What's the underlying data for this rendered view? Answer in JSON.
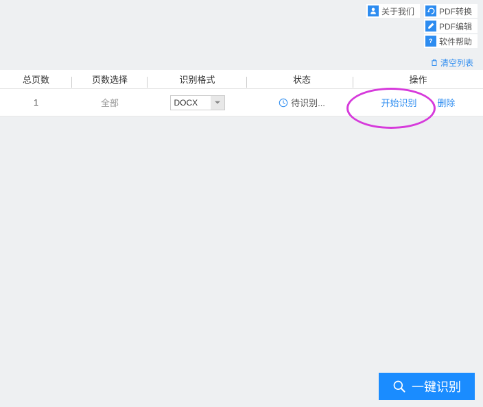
{
  "toolbar": {
    "about_us": "关于我们",
    "pdf_convert": "PDF转换",
    "pdf_edit": "PDF编辑",
    "software_help": "软件帮助"
  },
  "clear_list": "清空列表",
  "headers": {
    "total_pages": "总页数",
    "page_select": "页数选择",
    "format": "识别格式",
    "status": "状态",
    "operation": "操作"
  },
  "row": {
    "total_pages": "1",
    "page_select": "全部",
    "format": "DOCX",
    "status": "待识别...",
    "start": "开始识别",
    "delete": "删除"
  },
  "button": {
    "one_click": "一键识别"
  }
}
